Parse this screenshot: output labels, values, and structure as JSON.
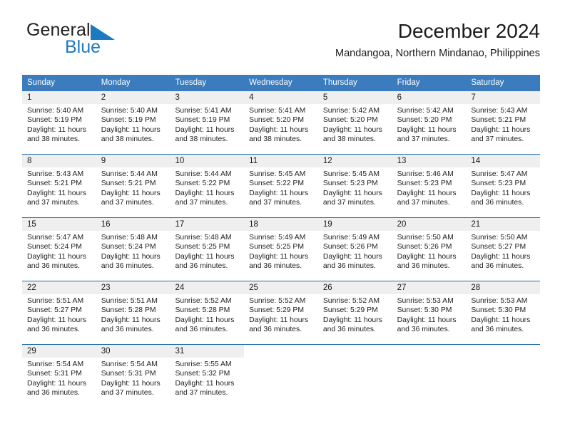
{
  "brand": {
    "name_part1": "General",
    "name_part2": "Blue",
    "flag_color": "#1c7ac0"
  },
  "header": {
    "title": "December 2024",
    "subtitle": "Mandangoa, Northern Mindanao, Philippines"
  },
  "theme": {
    "header_blue": "#3a7cbe",
    "row_divider_blue": "#1f6cb0",
    "daynum_band_gray": "#efefef",
    "text_color": "#1a1a1a"
  },
  "weekdays": [
    "Sunday",
    "Monday",
    "Tuesday",
    "Wednesday",
    "Thursday",
    "Friday",
    "Saturday"
  ],
  "weeks": [
    [
      {
        "day": "1",
        "sunrise": "Sunrise: 5:40 AM",
        "sunset": "Sunset: 5:19 PM",
        "daylight1": "Daylight: 11 hours",
        "daylight2": "and 38 minutes."
      },
      {
        "day": "2",
        "sunrise": "Sunrise: 5:40 AM",
        "sunset": "Sunset: 5:19 PM",
        "daylight1": "Daylight: 11 hours",
        "daylight2": "and 38 minutes."
      },
      {
        "day": "3",
        "sunrise": "Sunrise: 5:41 AM",
        "sunset": "Sunset: 5:19 PM",
        "daylight1": "Daylight: 11 hours",
        "daylight2": "and 38 minutes."
      },
      {
        "day": "4",
        "sunrise": "Sunrise: 5:41 AM",
        "sunset": "Sunset: 5:20 PM",
        "daylight1": "Daylight: 11 hours",
        "daylight2": "and 38 minutes."
      },
      {
        "day": "5",
        "sunrise": "Sunrise: 5:42 AM",
        "sunset": "Sunset: 5:20 PM",
        "daylight1": "Daylight: 11 hours",
        "daylight2": "and 38 minutes."
      },
      {
        "day": "6",
        "sunrise": "Sunrise: 5:42 AM",
        "sunset": "Sunset: 5:20 PM",
        "daylight1": "Daylight: 11 hours",
        "daylight2": "and 37 minutes."
      },
      {
        "day": "7",
        "sunrise": "Sunrise: 5:43 AM",
        "sunset": "Sunset: 5:21 PM",
        "daylight1": "Daylight: 11 hours",
        "daylight2": "and 37 minutes."
      }
    ],
    [
      {
        "day": "8",
        "sunrise": "Sunrise: 5:43 AM",
        "sunset": "Sunset: 5:21 PM",
        "daylight1": "Daylight: 11 hours",
        "daylight2": "and 37 minutes."
      },
      {
        "day": "9",
        "sunrise": "Sunrise: 5:44 AM",
        "sunset": "Sunset: 5:21 PM",
        "daylight1": "Daylight: 11 hours",
        "daylight2": "and 37 minutes."
      },
      {
        "day": "10",
        "sunrise": "Sunrise: 5:44 AM",
        "sunset": "Sunset: 5:22 PM",
        "daylight1": "Daylight: 11 hours",
        "daylight2": "and 37 minutes."
      },
      {
        "day": "11",
        "sunrise": "Sunrise: 5:45 AM",
        "sunset": "Sunset: 5:22 PM",
        "daylight1": "Daylight: 11 hours",
        "daylight2": "and 37 minutes."
      },
      {
        "day": "12",
        "sunrise": "Sunrise: 5:45 AM",
        "sunset": "Sunset: 5:23 PM",
        "daylight1": "Daylight: 11 hours",
        "daylight2": "and 37 minutes."
      },
      {
        "day": "13",
        "sunrise": "Sunrise: 5:46 AM",
        "sunset": "Sunset: 5:23 PM",
        "daylight1": "Daylight: 11 hours",
        "daylight2": "and 37 minutes."
      },
      {
        "day": "14",
        "sunrise": "Sunrise: 5:47 AM",
        "sunset": "Sunset: 5:23 PM",
        "daylight1": "Daylight: 11 hours",
        "daylight2": "and 36 minutes."
      }
    ],
    [
      {
        "day": "15",
        "sunrise": "Sunrise: 5:47 AM",
        "sunset": "Sunset: 5:24 PM",
        "daylight1": "Daylight: 11 hours",
        "daylight2": "and 36 minutes."
      },
      {
        "day": "16",
        "sunrise": "Sunrise: 5:48 AM",
        "sunset": "Sunset: 5:24 PM",
        "daylight1": "Daylight: 11 hours",
        "daylight2": "and 36 minutes."
      },
      {
        "day": "17",
        "sunrise": "Sunrise: 5:48 AM",
        "sunset": "Sunset: 5:25 PM",
        "daylight1": "Daylight: 11 hours",
        "daylight2": "and 36 minutes."
      },
      {
        "day": "18",
        "sunrise": "Sunrise: 5:49 AM",
        "sunset": "Sunset: 5:25 PM",
        "daylight1": "Daylight: 11 hours",
        "daylight2": "and 36 minutes."
      },
      {
        "day": "19",
        "sunrise": "Sunrise: 5:49 AM",
        "sunset": "Sunset: 5:26 PM",
        "daylight1": "Daylight: 11 hours",
        "daylight2": "and 36 minutes."
      },
      {
        "day": "20",
        "sunrise": "Sunrise: 5:50 AM",
        "sunset": "Sunset: 5:26 PM",
        "daylight1": "Daylight: 11 hours",
        "daylight2": "and 36 minutes."
      },
      {
        "day": "21",
        "sunrise": "Sunrise: 5:50 AM",
        "sunset": "Sunset: 5:27 PM",
        "daylight1": "Daylight: 11 hours",
        "daylight2": "and 36 minutes."
      }
    ],
    [
      {
        "day": "22",
        "sunrise": "Sunrise: 5:51 AM",
        "sunset": "Sunset: 5:27 PM",
        "daylight1": "Daylight: 11 hours",
        "daylight2": "and 36 minutes."
      },
      {
        "day": "23",
        "sunrise": "Sunrise: 5:51 AM",
        "sunset": "Sunset: 5:28 PM",
        "daylight1": "Daylight: 11 hours",
        "daylight2": "and 36 minutes."
      },
      {
        "day": "24",
        "sunrise": "Sunrise: 5:52 AM",
        "sunset": "Sunset: 5:28 PM",
        "daylight1": "Daylight: 11 hours",
        "daylight2": "and 36 minutes."
      },
      {
        "day": "25",
        "sunrise": "Sunrise: 5:52 AM",
        "sunset": "Sunset: 5:29 PM",
        "daylight1": "Daylight: 11 hours",
        "daylight2": "and 36 minutes."
      },
      {
        "day": "26",
        "sunrise": "Sunrise: 5:52 AM",
        "sunset": "Sunset: 5:29 PM",
        "daylight1": "Daylight: 11 hours",
        "daylight2": "and 36 minutes."
      },
      {
        "day": "27",
        "sunrise": "Sunrise: 5:53 AM",
        "sunset": "Sunset: 5:30 PM",
        "daylight1": "Daylight: 11 hours",
        "daylight2": "and 36 minutes."
      },
      {
        "day": "28",
        "sunrise": "Sunrise: 5:53 AM",
        "sunset": "Sunset: 5:30 PM",
        "daylight1": "Daylight: 11 hours",
        "daylight2": "and 36 minutes."
      }
    ],
    [
      {
        "day": "29",
        "sunrise": "Sunrise: 5:54 AM",
        "sunset": "Sunset: 5:31 PM",
        "daylight1": "Daylight: 11 hours",
        "daylight2": "and 36 minutes."
      },
      {
        "day": "30",
        "sunrise": "Sunrise: 5:54 AM",
        "sunset": "Sunset: 5:31 PM",
        "daylight1": "Daylight: 11 hours",
        "daylight2": "and 37 minutes."
      },
      {
        "day": "31",
        "sunrise": "Sunrise: 5:55 AM",
        "sunset": "Sunset: 5:32 PM",
        "daylight1": "Daylight: 11 hours",
        "daylight2": "and 37 minutes."
      },
      {
        "day": "",
        "sunrise": "",
        "sunset": "",
        "daylight1": "",
        "daylight2": ""
      },
      {
        "day": "",
        "sunrise": "",
        "sunset": "",
        "daylight1": "",
        "daylight2": ""
      },
      {
        "day": "",
        "sunrise": "",
        "sunset": "",
        "daylight1": "",
        "daylight2": ""
      },
      {
        "day": "",
        "sunrise": "",
        "sunset": "",
        "daylight1": "",
        "daylight2": ""
      }
    ]
  ]
}
